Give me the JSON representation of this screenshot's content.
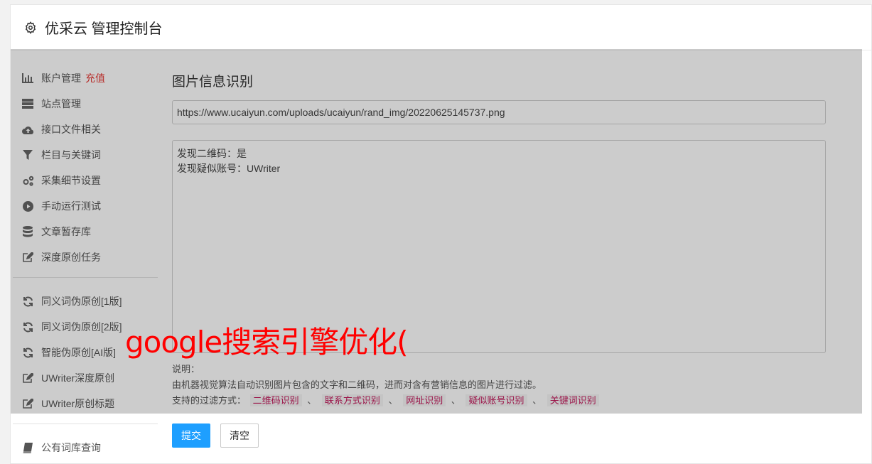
{
  "header": {
    "title": "优采云 管理控制台"
  },
  "sidebar": {
    "group1": [
      {
        "label": "账户管理",
        "badge": "充值",
        "icon": "bar-chart-icon"
      },
      {
        "label": "站点管理",
        "icon": "server-icon"
      },
      {
        "label": "接口文件相关",
        "icon": "cloud-upload-icon"
      },
      {
        "label": "栏目与关键词",
        "icon": "filter-icon"
      },
      {
        "label": "采集细节设置",
        "icon": "gears-icon"
      },
      {
        "label": "手动运行测试",
        "icon": "play-circle-icon"
      },
      {
        "label": "文章暂存库",
        "icon": "database-icon"
      },
      {
        "label": "深度原创任务",
        "icon": "edit-icon"
      }
    ],
    "group2": [
      {
        "label": "同义词伪原创[1版]",
        "icon": "refresh-icon"
      },
      {
        "label": "同义词伪原创[2版]",
        "icon": "refresh-icon"
      },
      {
        "label": "智能伪原创[AI版]",
        "icon": "refresh-icon"
      },
      {
        "label": "UWriter深度原创",
        "icon": "edit-icon"
      },
      {
        "label": "UWriter原创标题",
        "icon": "edit-icon"
      }
    ],
    "group3": [
      {
        "label": "公有词库查询",
        "icon": "book-icon"
      }
    ]
  },
  "main": {
    "section_title": "图片信息识别",
    "url_value": "https://www.ucaiyun.com/uploads/ucaiyun/rand_img/20220625145737.png",
    "result_lines": [
      "发现二维码：是",
      "发现疑似账号：UWriter"
    ],
    "notes_label": "说明：",
    "notes_desc": "由机器视觉算法自动识别图片包含的文字和二维码，进而对含有营销信息的图片进行过滤。",
    "filter_label": "支持的过滤方式：",
    "filters": [
      "二维码识别",
      "联系方式识别",
      "网址识别",
      "疑似账号识别",
      "关键词识别"
    ],
    "separator": "、"
  },
  "buttons": {
    "submit": "提交",
    "clear": "清空"
  },
  "watermark": "google搜索引擎优化(",
  "colors": {
    "primary": "#1e9fff",
    "badge_red": "#e53935",
    "tag_pink": "#c2185b",
    "watermark": "#ff0000"
  }
}
